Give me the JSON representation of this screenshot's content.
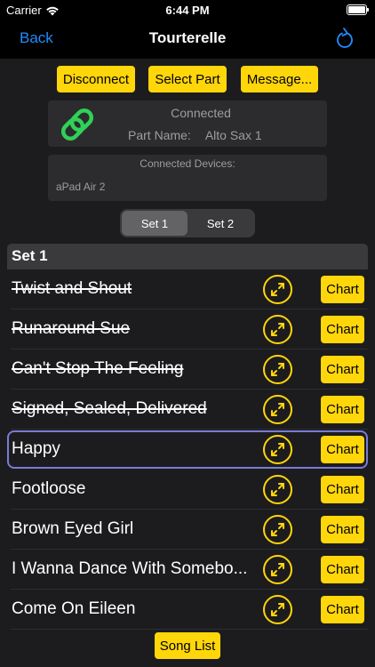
{
  "status_bar": {
    "carrier": "Carrier",
    "time": "6:44 PM"
  },
  "nav": {
    "back_label": "Back",
    "title": "Tourterelle",
    "refresh_icon": "refresh-icon"
  },
  "actions": {
    "disconnect_label": "Disconnect",
    "select_part_label": "Select Part",
    "message_label": "Message..."
  },
  "connection": {
    "status": "Connected",
    "part_label": "Part Name:",
    "part_value": "Alto Sax 1",
    "icon": "link-icon",
    "icon_color": "#30d158"
  },
  "devices": {
    "title": "Connected Devices:",
    "items": [
      "aPad Air 2"
    ]
  },
  "set_tabs": [
    {
      "label": "Set 1",
      "active": true
    },
    {
      "label": "Set 2",
      "active": false
    }
  ],
  "section": {
    "title": "Set 1"
  },
  "songs": [
    {
      "title": "Twist and Shout",
      "played": true,
      "selected": false,
      "chart_label": "Chart"
    },
    {
      "title": "Runaround Sue",
      "played": true,
      "selected": false,
      "chart_label": "Chart"
    },
    {
      "title": "Can't Stop The Feeling",
      "played": true,
      "selected": false,
      "chart_label": "Chart"
    },
    {
      "title": "Signed, Sealed, Delivered",
      "played": true,
      "selected": false,
      "chart_label": "Chart"
    },
    {
      "title": "Happy",
      "played": false,
      "selected": true,
      "chart_label": "Chart"
    },
    {
      "title": "Footloose",
      "played": false,
      "selected": false,
      "chart_label": "Chart"
    },
    {
      "title": "Brown Eyed Girl",
      "played": false,
      "selected": false,
      "chart_label": "Chart"
    },
    {
      "title": "I Wanna Dance With Somebo...",
      "played": false,
      "selected": false,
      "chart_label": "Chart"
    },
    {
      "title": "Come On Eileen",
      "played": false,
      "selected": false,
      "chart_label": "Chart"
    }
  ],
  "footer": {
    "song_list_label": "Song List"
  },
  "colors": {
    "accent": "#ffd60a",
    "link_blue": "#1e8cff",
    "selection": "#7b7bd6"
  }
}
